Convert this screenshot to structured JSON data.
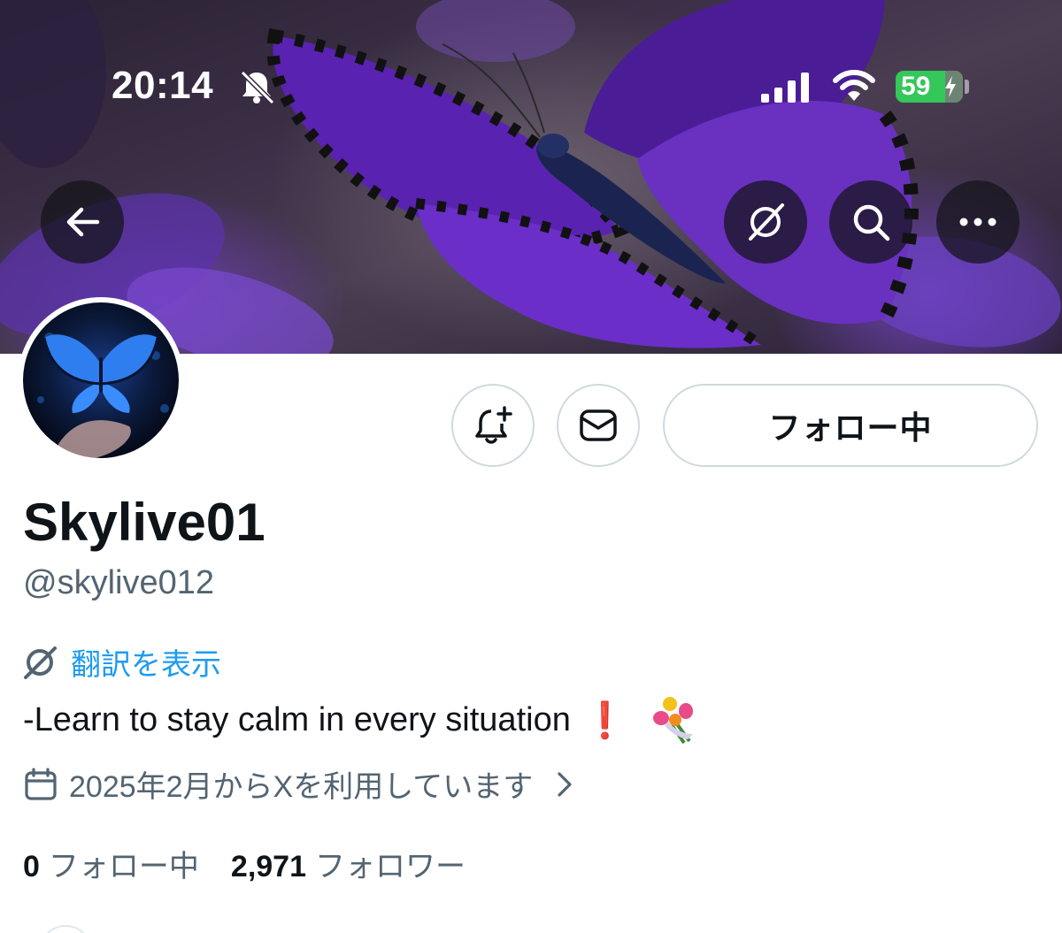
{
  "status_bar": {
    "time": "20:14",
    "battery": "59",
    "icons": [
      "mute-bell-icon",
      "signal-icon",
      "wifi-icon",
      "battery-charging-icon"
    ]
  },
  "banner": {
    "icons": [
      "back-arrow-icon",
      "translate-icon",
      "search-icon",
      "more-icon"
    ]
  },
  "profile": {
    "display_name": "Skylive01",
    "handle": "@skylive012",
    "translate_link": "翻訳を表示",
    "bio": "-Learn to stay calm in every situation",
    "bio_emoji": "❗",
    "joined": "2025年2月からXを利用しています",
    "following_count": "0",
    "following_label": "フォロー中",
    "followers_count": "2,971",
    "followers_label": "フォロワー"
  },
  "actions": {
    "follow_label": "フォロー中",
    "icons": [
      "notification-add-icon",
      "message-icon"
    ]
  },
  "colors": {
    "accent": "#1d9bf0",
    "secondary_text": "#536471",
    "primary_text": "#0f1419",
    "border": "#cfd9de",
    "battery": "#34c759"
  }
}
